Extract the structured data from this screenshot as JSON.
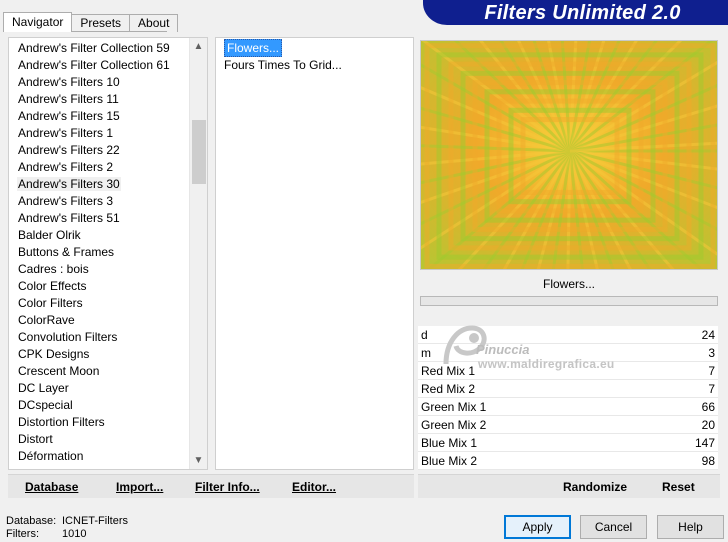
{
  "tabs": [
    "Navigator",
    "Presets",
    "About"
  ],
  "banner_title": "Filters Unlimited 2.0",
  "categories": [
    "Andrew's Filter Collection 59",
    "Andrew's Filter Collection 61",
    "Andrew's Filters 10",
    "Andrew's Filters 11",
    "Andrew's Filters 15",
    "Andrew's Filters 1",
    "Andrew's Filters 22",
    "Andrew's Filters 2",
    "Andrew's Filters 30",
    "Andrew's Filters 3",
    "Andrew's Filters 51",
    "Balder Olrik",
    "Buttons & Frames",
    "Cadres : bois",
    "Color Effects",
    "Color Filters",
    "ColorRave",
    "Convolution Filters",
    "CPK Designs",
    "Crescent Moon",
    "DC Layer",
    "DCspecial",
    "Distortion Filters",
    "Distort",
    "Déformation"
  ],
  "selected_category": "Andrew's Filters 30",
  "filters": [
    "Flowers...",
    "Fours Times To Grid..."
  ],
  "selected_filter": "Flowers...",
  "preview_caption": "Flowers...",
  "params": [
    {
      "label": "d",
      "value": "24"
    },
    {
      "label": "m",
      "value": "3"
    },
    {
      "label": "Red Mix 1",
      "value": "7"
    },
    {
      "label": "Red Mix 2",
      "value": "7"
    },
    {
      "label": "Green Mix 1",
      "value": "66"
    },
    {
      "label": "Green Mix 2",
      "value": "20"
    },
    {
      "label": "Blue Mix 1",
      "value": "147"
    },
    {
      "label": "Blue Mix 2",
      "value": "98"
    }
  ],
  "toolbar": {
    "database": "Database",
    "import": "Import...",
    "filter_info": "Filter Info...",
    "editor": "Editor...",
    "randomize": "Randomize",
    "reset": "Reset"
  },
  "status": {
    "database_label": "Database:",
    "database_value": "ICNET-Filters",
    "filters_label": "Filters:",
    "filters_value": "1010"
  },
  "buttons": {
    "apply": "Apply",
    "cancel": "Cancel",
    "help": "Help"
  },
  "watermark": {
    "line1": "Pinuccia",
    "line2": "www.maldiregrafica.eu"
  },
  "colors": {
    "banner": "#0f1f8f",
    "selection": "#3399ff",
    "preview_orange": "#f0a92a",
    "preview_green": "#9ccc2e"
  }
}
